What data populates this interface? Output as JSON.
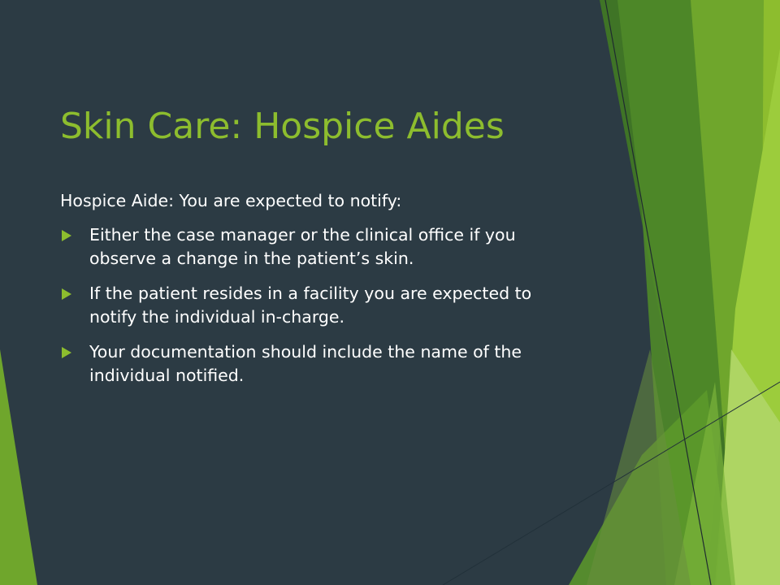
{
  "slide": {
    "title": "Skin Care: Hospice Aides",
    "intro": "Hospice Aide:  You are expected to notify:",
    "bullets": [
      "Either the case manager or the clinical office if you observe a change in the patient’s skin.",
      "If the patient resides in a facility you are expected to notify the individual in-charge.",
      "Your documentation should include the name of the individual notified."
    ]
  },
  "colors": {
    "background": "#2c3b44",
    "accent": "#8dbd2e",
    "text": "#ffffff"
  },
  "icons": {
    "bullet": "triangle-right-icon"
  }
}
